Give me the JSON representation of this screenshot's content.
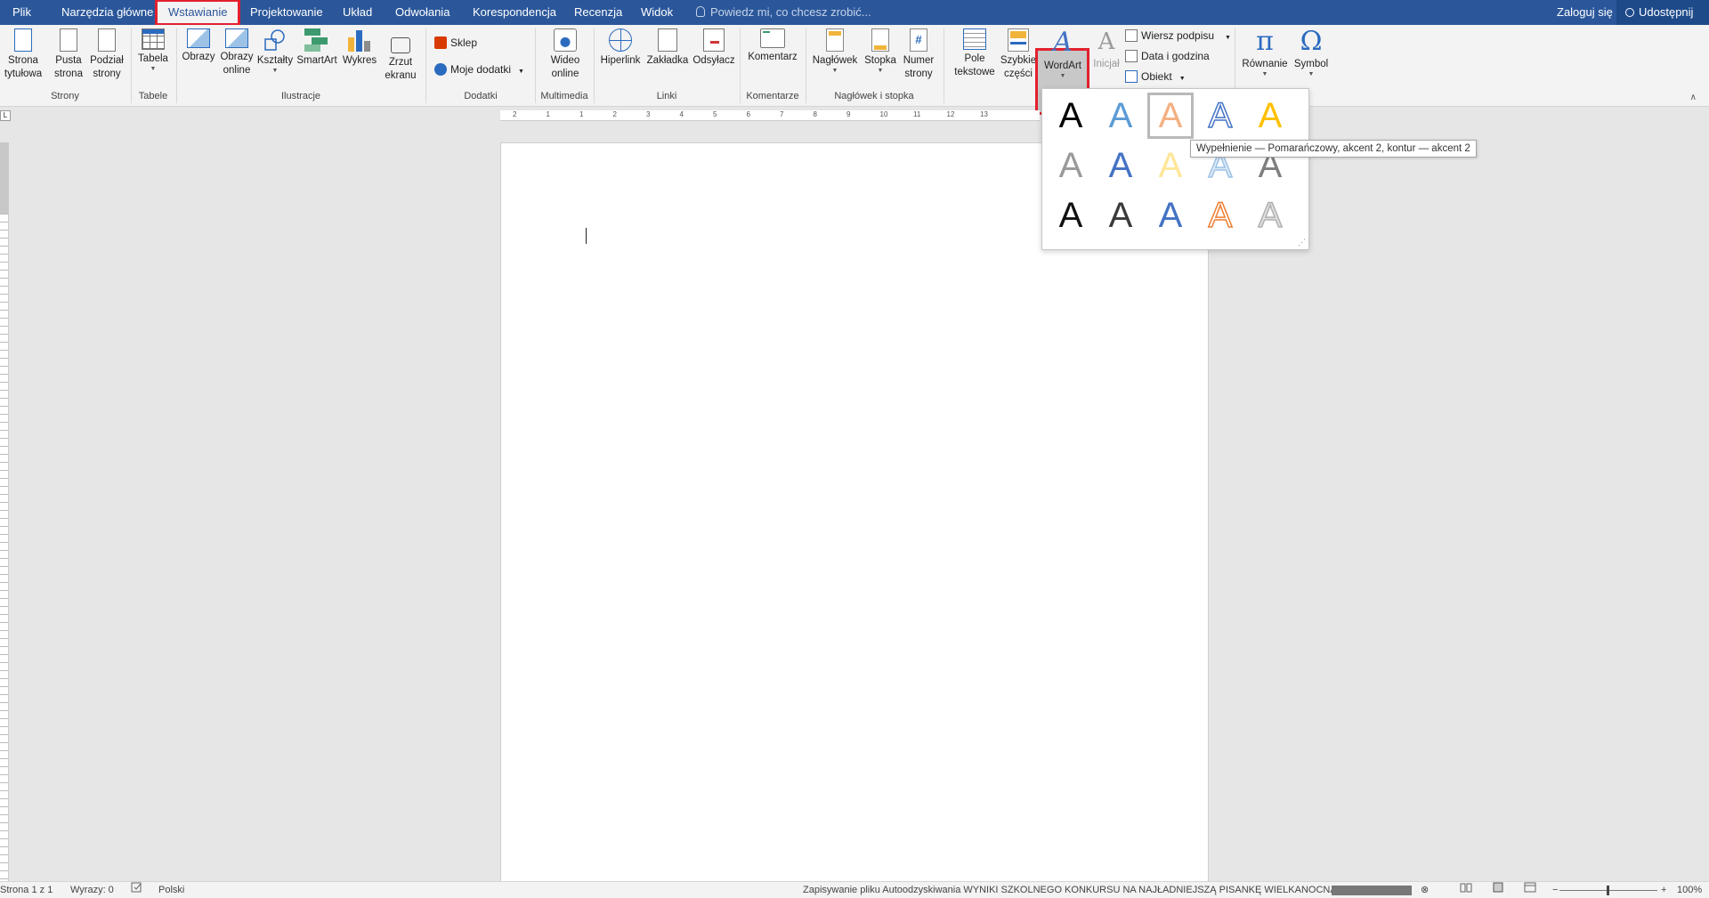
{
  "tabs": {
    "file": "Plik",
    "home": "Narzędzia główne",
    "insert": "Wstawianie",
    "design": "Projektowanie",
    "layout": "Układ",
    "references": "Odwołania",
    "mailings": "Korespondencja",
    "review": "Recenzja",
    "view": "Widok"
  },
  "tell_me_placeholder": "Powiedz mi, co chcesz zrobić...",
  "account": {
    "sign_in": "Zaloguj się",
    "share": "Udostępnij"
  },
  "ribbon": {
    "groups": {
      "pages": "Strony",
      "tables": "Tabele",
      "illustrations": "Ilustracje",
      "addins": "Dodatki",
      "media": "Multimedia",
      "links": "Linki",
      "comments": "Komentarze",
      "header_footer": "Nagłówek i stopka"
    },
    "buttons": {
      "cover_page_1": "Strona",
      "cover_page_2": "tytułowa",
      "blank_page_1": "Pusta",
      "blank_page_2": "strona",
      "page_break_1": "Podział",
      "page_break_2": "strony",
      "table": "Tabela",
      "pictures": "Obrazy",
      "online_pictures_1": "Obrazy",
      "online_pictures_2": "online",
      "shapes": "Kształty",
      "smartart": "SmartArt",
      "chart": "Wykres",
      "screenshot_1": "Zrzut",
      "screenshot_2": "ekranu",
      "store": "Sklep",
      "my_addins": "Moje dodatki",
      "online_video_1": "Wideo",
      "online_video_2": "online",
      "hyperlink": "Hiperlink",
      "bookmark": "Zakładka",
      "cross_reference": "Odsyłacz",
      "comment": "Komentarz",
      "header": "Nagłówek",
      "footer": "Stopka",
      "page_number_1": "Numer",
      "page_number_2": "strony",
      "text_box_1": "Pole",
      "text_box_2": "tekstowe",
      "quick_parts_1": "Szybkie",
      "quick_parts_2": "części",
      "wordart": "WordArt",
      "drop_cap": "Inicjał",
      "signature_line": "Wiersz podpisu",
      "date_time": "Data i godzina",
      "object": "Obiekt",
      "equation": "Równanie",
      "symbol": "Symbol"
    },
    "glyphs": {
      "wordart": "A",
      "drop_cap": "A",
      "equation": "π",
      "symbol": "Ω",
      "page_number": "#"
    }
  },
  "ruler": {
    "corner": "L",
    "ticks": [
      "2",
      "1",
      "1",
      "2",
      "3",
      "4",
      "5",
      "6",
      "7",
      "8",
      "9",
      "10",
      "11",
      "12",
      "13"
    ]
  },
  "wordart_gallery": {
    "items": [
      {
        "glyph": "A",
        "color": "#000000"
      },
      {
        "glyph": "A",
        "color": "#5b9bd5"
      },
      {
        "glyph": "A",
        "color": "#f4b183",
        "selected": true
      },
      {
        "glyph": "A",
        "color": "#ffffff",
        "outline": "#4472c4"
      },
      {
        "glyph": "A",
        "color": "#ffc000"
      },
      {
        "glyph": "A",
        "color": "#9a9a9a"
      },
      {
        "glyph": "A",
        "color": "#4472c4"
      },
      {
        "glyph": "A",
        "color": "#ffe699"
      },
      {
        "glyph": "A",
        "color": "#dde8f5",
        "outline": "#9dc3e6"
      },
      {
        "glyph": "A",
        "color": "#7f7f7f"
      },
      {
        "glyph": "A",
        "color": "#111111"
      },
      {
        "glyph": "A",
        "color": "#3a3a3a"
      },
      {
        "glyph": "A",
        "color": "#4472c4"
      },
      {
        "glyph": "A",
        "color": "#ffffff",
        "outline": "#ed7d31"
      },
      {
        "glyph": "A",
        "color": "#e0e0e0",
        "outline": "#b0b0b0"
      }
    ],
    "tooltip": "Wypełnienie — Pomarańczowy, akcent 2, kontur — akcent 2"
  },
  "statusbar": {
    "page": "Strona 1 z 1",
    "words": "Wyrazy: 0",
    "language": "Polski",
    "autosave": "Zapisywanie pliku Autoodzyskiwania WYNIKI SZKOLNEGO  KONKURSU NA NAJŁADNIEJSZĄ PISANKĘ WIELKANOCNĄ:",
    "zoom_minus": "−",
    "zoom_plus": "+",
    "zoom": "100%"
  },
  "colors": {
    "accent": "#2b579a",
    "highlight": "#e3202d"
  }
}
